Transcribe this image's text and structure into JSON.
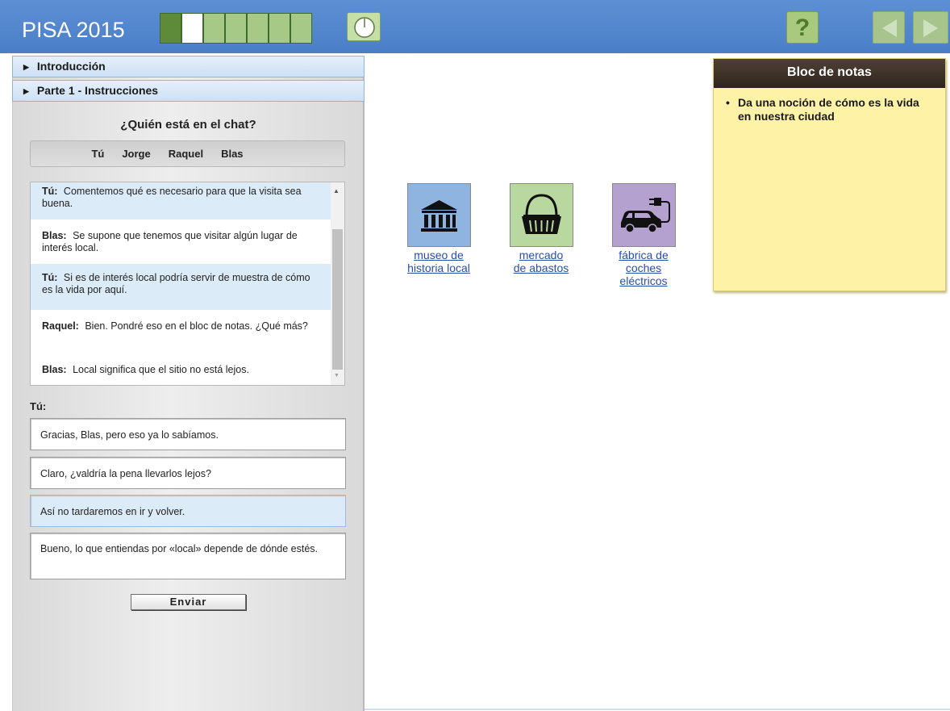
{
  "header": {
    "app_title": "PISA 2015",
    "progress": {
      "total_steps": 7,
      "completed": 1,
      "current": 2
    },
    "help_label": "?",
    "colors": {
      "header_bg": "#5289cf",
      "button_green": "#a8c97e"
    }
  },
  "accordion": [
    {
      "label": "Introducción"
    },
    {
      "label": "Parte 1 - Instrucciones"
    }
  ],
  "chat": {
    "title": "¿Quién está en el chat?",
    "participants": [
      "Tú",
      "Jorge",
      "Raquel",
      "Blas"
    ],
    "messages": [
      {
        "speaker": "Tú:",
        "text": "Comentemos qué es necesario para que la visita sea buena."
      },
      {
        "speaker": "Blas:",
        "text": "Se supone que tenemos que visitar algún lugar de interés local."
      },
      {
        "speaker": "Tú:",
        "text": "Si es de interés local podría servir de muestra de cómo es la vida por aquí."
      },
      {
        "speaker": "Raquel:",
        "text": "Bien. Pondré eso en el bloc de notas. ¿Qué más?"
      },
      {
        "speaker": "Blas:",
        "text": "Local significa que el sitio no está lejos."
      }
    ],
    "you_label": "Tú:",
    "options": [
      {
        "text": "Gracias, Blas, pero eso ya lo sabíamos.",
        "selected": false
      },
      {
        "text": "Claro, ¿valdría la pena llevarlos lejos?",
        "selected": false
      },
      {
        "text": "Así no tardaremos en ir y volver.",
        "selected": true
      },
      {
        "text": "Bueno, lo que entiendas por «local» depende de dónde estés.",
        "selected": false
      }
    ],
    "send_label": "Enviar"
  },
  "places": [
    {
      "label_line1": "museo de",
      "label_line2": "historia local",
      "icon": "museum-icon"
    },
    {
      "label_line1": "mercado",
      "label_line2": "de abastos",
      "icon": "basket-icon"
    },
    {
      "label_line1": "fábrica de",
      "label_line2": "coches",
      "label_line3": "eléctricos",
      "icon": "electric-car-icon"
    }
  ],
  "notepad": {
    "title": "Bloc de notas",
    "items": [
      "Da una noción de cómo es la vida en nuestra ciudad"
    ]
  }
}
